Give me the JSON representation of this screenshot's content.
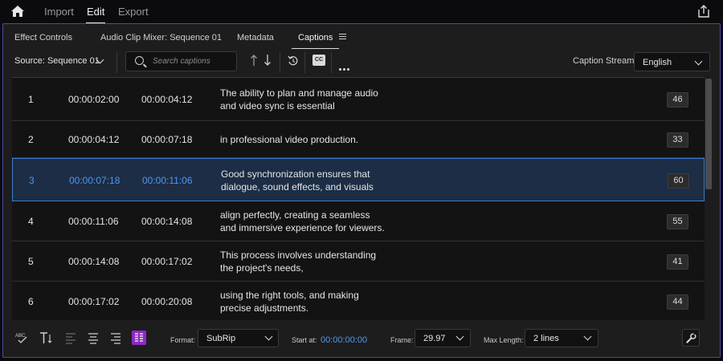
{
  "app": {
    "nav": [
      "Import",
      "Edit",
      "Export"
    ],
    "active_nav": "Edit"
  },
  "panel": {
    "tabs": [
      {
        "label": "Effect Controls"
      },
      {
        "label": "Audio Clip Mixer: Sequence 01"
      },
      {
        "label": "Metadata"
      },
      {
        "label": "Captions"
      }
    ],
    "active_tab": "Captions"
  },
  "toolbar": {
    "source_label": "Source: Sequence 01",
    "search_placeholder": "Search captions",
    "cc_label": "CC",
    "caption_stream_label": "Caption Stream:",
    "caption_stream_value": "English"
  },
  "captions": [
    {
      "num": "1",
      "in": "00:00:02:00",
      "out": "00:00:04:12",
      "text": "The ability to plan and manage audio\nand video sync is essential",
      "count": "46"
    },
    {
      "num": "2",
      "in": "00:00:04:12",
      "out": "00:00:07:18",
      "text": "in professional video production.",
      "count": "33"
    },
    {
      "num": "3",
      "in": "00:00:07:18",
      "out": "00:00:11:06",
      "text": "Good synchronization ensures that\ndialogue, sound effects, and visuals",
      "count": "60"
    },
    {
      "num": "4",
      "in": "00:00:11:06",
      "out": "00:00:14:08",
      "text": "align perfectly, creating a seamless\nand immersive experience for viewers.",
      "count": "55"
    },
    {
      "num": "5",
      "in": "00:00:14:08",
      "out": "00:00:17:02",
      "text": "This process involves understanding\nthe project's needs,",
      "count": "41"
    },
    {
      "num": "6",
      "in": "00:00:17:02",
      "out": "00:00:20:08",
      "text": "using the right tools, and making\nprecise adjustments.",
      "count": "44"
    }
  ],
  "selected_caption": "3",
  "bottom": {
    "format_label": "Format:",
    "format_value": "SubRip",
    "start_label": "Start at:",
    "start_value": "00:00:00:00",
    "frame_label": "Frame:",
    "frame_value": "29.97",
    "maxlen_label": "Max Length:",
    "maxlen_value": "2 lines"
  },
  "colors": {
    "accent": "#4e97f2",
    "active_tool": "#8e2ac4",
    "panel_border": "#4c4aa8"
  }
}
